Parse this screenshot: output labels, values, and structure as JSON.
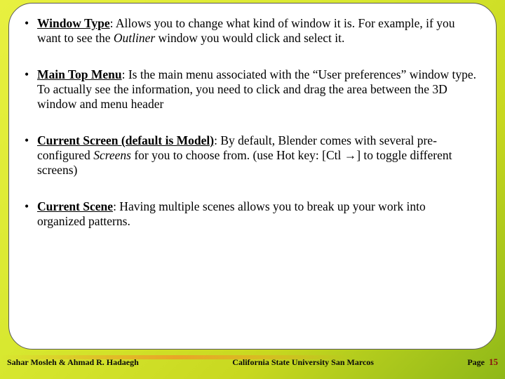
{
  "bullets": [
    {
      "title": "Window Type",
      "body_html": ": Allows you to change what kind of window it is. For example, if you want to see the <span class=\"italic\">Outliner</span> window you would click and select it."
    },
    {
      "title": "Main Top Menu",
      "body_html": ": Is the main menu associated with the “User preferences”  window type. To actually see the information, you need to click and drag the area between the 3D window and menu header"
    },
    {
      "title": "Current Screen (default is Model)",
      "body_html": ": By default, Blender comes with several pre-configured <span class=\"italic\">Screens</span> for you to choose from. (use Hot key: [Ctl →] to toggle different screens)"
    },
    {
      "title": "Current Scene",
      "body_html": ": Having multiple scenes allows you to break up your work into organized patterns."
    }
  ],
  "footer": {
    "left": "Sahar Mosleh & Ahmad R. Hadaegh",
    "center": "California State University San Marcos",
    "page_label": "Page",
    "page_number": "15"
  }
}
